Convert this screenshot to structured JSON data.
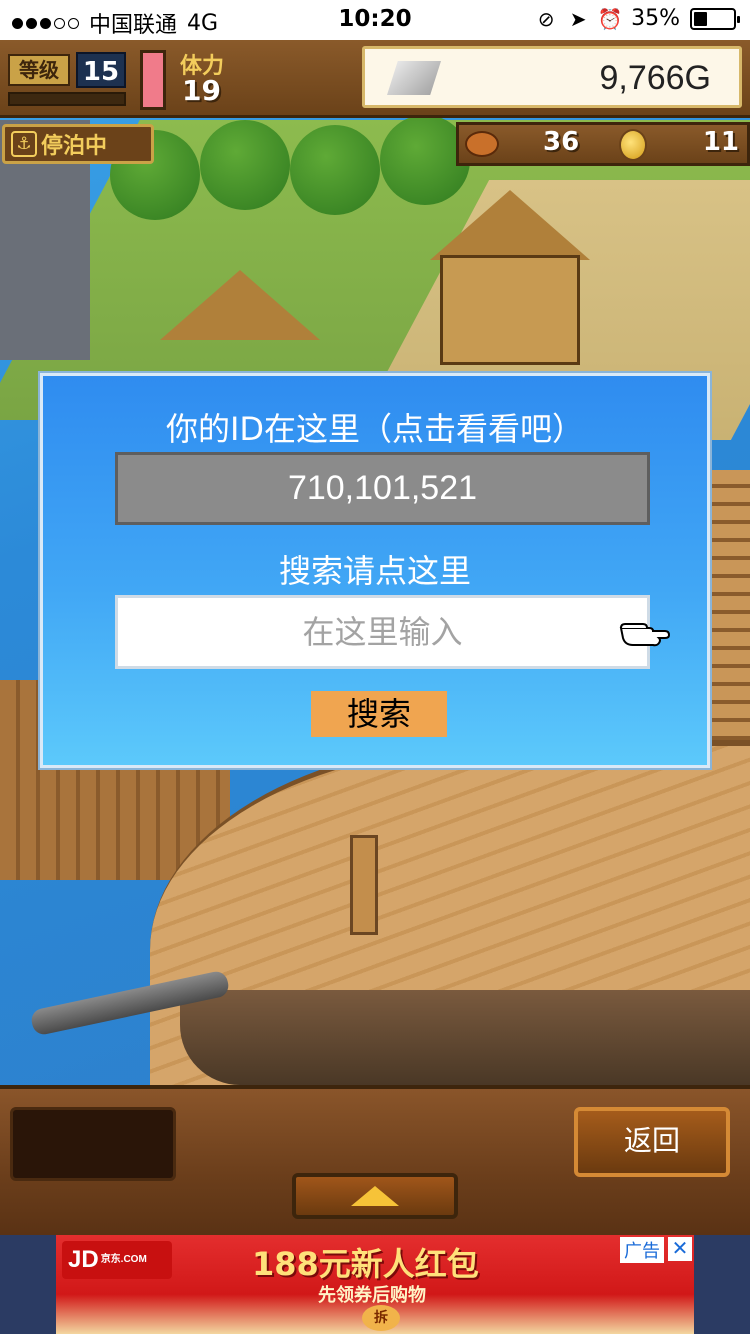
{
  "status_bar": {
    "carrier": "中国联通",
    "network": "4G",
    "time": "10:20",
    "battery_percent": "35%",
    "signal_bars_filled": 3,
    "signal_bars_total": 5,
    "battery_level": 0.35
  },
  "hud": {
    "level_label": "等级",
    "level_value": "15",
    "stamina_label": "体力",
    "stamina_value": "19",
    "gold": "9,766G",
    "status_badge": "停泊中",
    "food_value": "36",
    "medal_value": "11"
  },
  "dialog": {
    "title": "你的ID在这里（点击看看吧）",
    "id_value": "710,101,521",
    "search_label": "搜索请点这里",
    "input_placeholder": "在这里输入",
    "input_value": "",
    "search_button": "搜索"
  },
  "bottom_bar": {
    "back_button": "返回"
  },
  "ad": {
    "brand": "JD",
    "brand_domain": "京东.COM",
    "headline": "188元新人红包",
    "subline": "先领券后购物",
    "chip": "拆",
    "tag": "广告",
    "close": "✕"
  },
  "colors": {
    "dialog_top": "#2f8cf0",
    "dialog_bottom": "#5cc9fb",
    "search_button": "#f0a550",
    "id_box": "#8b8b8b"
  }
}
